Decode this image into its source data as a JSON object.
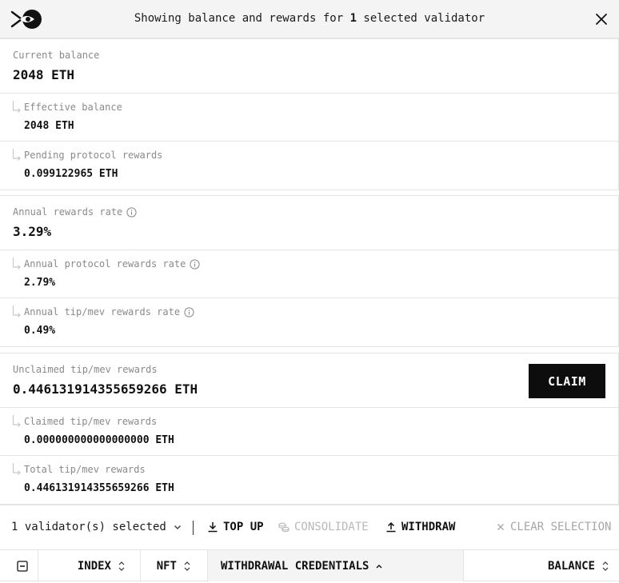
{
  "header": {
    "title_prefix": "Showing balance and rewards for ",
    "selected_count": "1",
    "title_suffix": " selected validator",
    "logo_icon": "fish-eye-logo-icon",
    "close_icon": "close-icon"
  },
  "balance": {
    "current_label": "Current balance",
    "current_value": "2048 ETH",
    "effective_label": "Effective balance",
    "effective_value": "2048 ETH",
    "pending_label": "Pending protocol rewards",
    "pending_value": "0.099122965 ETH"
  },
  "rates": {
    "annual_label": "Annual rewards rate",
    "annual_value": "3.29%",
    "protocol_label": "Annual protocol rewards rate",
    "protocol_value": "2.79%",
    "tipmev_label": "Annual tip/mev rewards rate",
    "tipmev_value": "0.49%"
  },
  "tipmev": {
    "unclaimed_label": "Unclaimed tip/mev rewards",
    "unclaimed_value": "0.446131914355659266 ETH",
    "claim_label": "CLAIM",
    "claimed_label": "Claimed tip/mev rewards",
    "claimed_value": "0.000000000000000000 ETH",
    "total_label": "Total tip/mev rewards",
    "total_value": "0.446131914355659266 ETH"
  },
  "toolbar": {
    "selection_label": "1 validator(s) selected",
    "top_up_label": "TOP UP",
    "consolidate_label": "CONSOLIDATE",
    "withdraw_label": "WITHDRAW",
    "clear_label": "CLEAR SELECTION"
  },
  "table": {
    "columns": [
      "INDEX",
      "NFT",
      "WITHDRAWAL CREDENTIALS",
      "BALANCE"
    ]
  },
  "colors": {
    "accent": "#0d0d0d",
    "muted_text": "#8a8a8a",
    "disabled_text": "#b9b9b9",
    "header_bg": "#f4f4f4",
    "border": "#e4e4e4"
  }
}
